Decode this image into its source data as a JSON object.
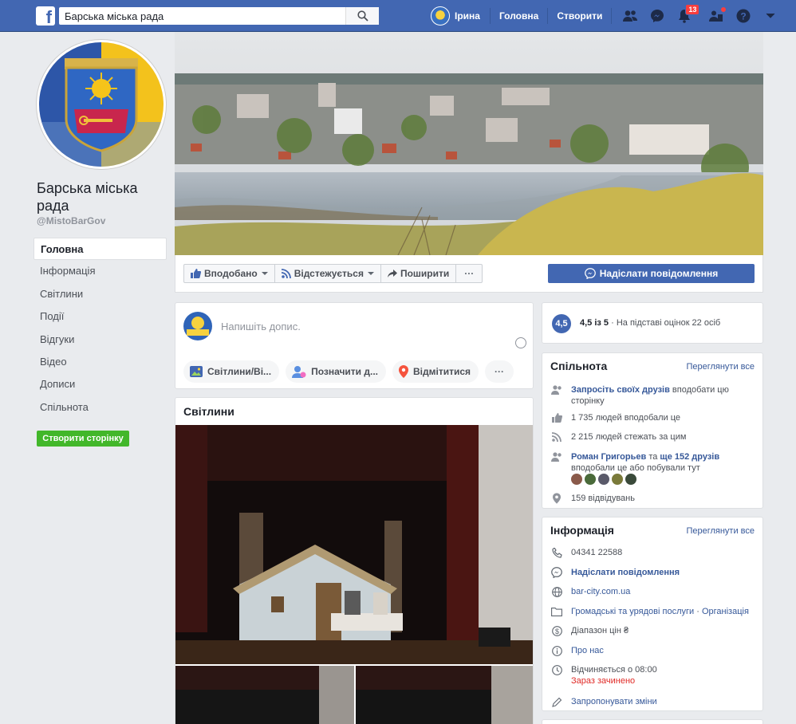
{
  "topbar": {
    "search_value": "Барська міська рада",
    "user_name": "Ірина",
    "home_label": "Головна",
    "create_label": "Створити",
    "notifications_count": "13"
  },
  "page": {
    "name": "Барська міська рада",
    "handle": "@MistoBarGov",
    "left_nav": [
      "Головна",
      "Інформація",
      "Світлини",
      "Події",
      "Відгуки",
      "Відео",
      "Дописи",
      "Спільнота"
    ],
    "create_page_label": "Створити сторінку"
  },
  "actions": {
    "liked_label": "Вподобано",
    "following_label": "Відстежується",
    "share_label": "Поширити",
    "more_label": "···",
    "message_label": "Надіслати повідомлення"
  },
  "composer": {
    "placeholder": "Напишіть допис.",
    "photo_label": "Світлини/Ві...",
    "tag_label": "Позначити д...",
    "checkin_label": "Відмітитися",
    "more_label": "···"
  },
  "photos": {
    "title": "Світлини"
  },
  "rating": {
    "score": "4,5",
    "text_bold": "4,5 із 5",
    "text_rest": " · На підставі оцінок 22 осіб"
  },
  "community": {
    "title": "Спільнота",
    "see_all": "Переглянути все",
    "invite_link": "Запросіть своїх друзів",
    "invite_rest": " вподобати цю сторінку",
    "likes": "1 735 людей вподобали це",
    "follows": "2 215 людей стежать за цим",
    "friend_name": "Роман Григорьев",
    "friend_and": " та ",
    "friend_more": "ще 152 друзів",
    "friend_rest": "вподобали це або побували тут",
    "visits": "159 відвідувань"
  },
  "info": {
    "title": "Інформація",
    "see_all": "Переглянути все",
    "phone": "04341 22588",
    "message": "Надіслати повідомлення",
    "website": "bar-city.com.ua",
    "category_1": "Громадські та урядові послуги",
    "category_sep": " · ",
    "category_2": "Організація",
    "price": "Діапазон цін ₴",
    "about": "Про нас",
    "hours": "Відчиняється о 08:00",
    "hours_status": "Зараз зачинено",
    "suggest": "Запропонувати зміни"
  },
  "colors": {
    "fb_blue": "#4267b2",
    "link": "#365899",
    "green": "#42b72a",
    "red": "#e02b27"
  }
}
